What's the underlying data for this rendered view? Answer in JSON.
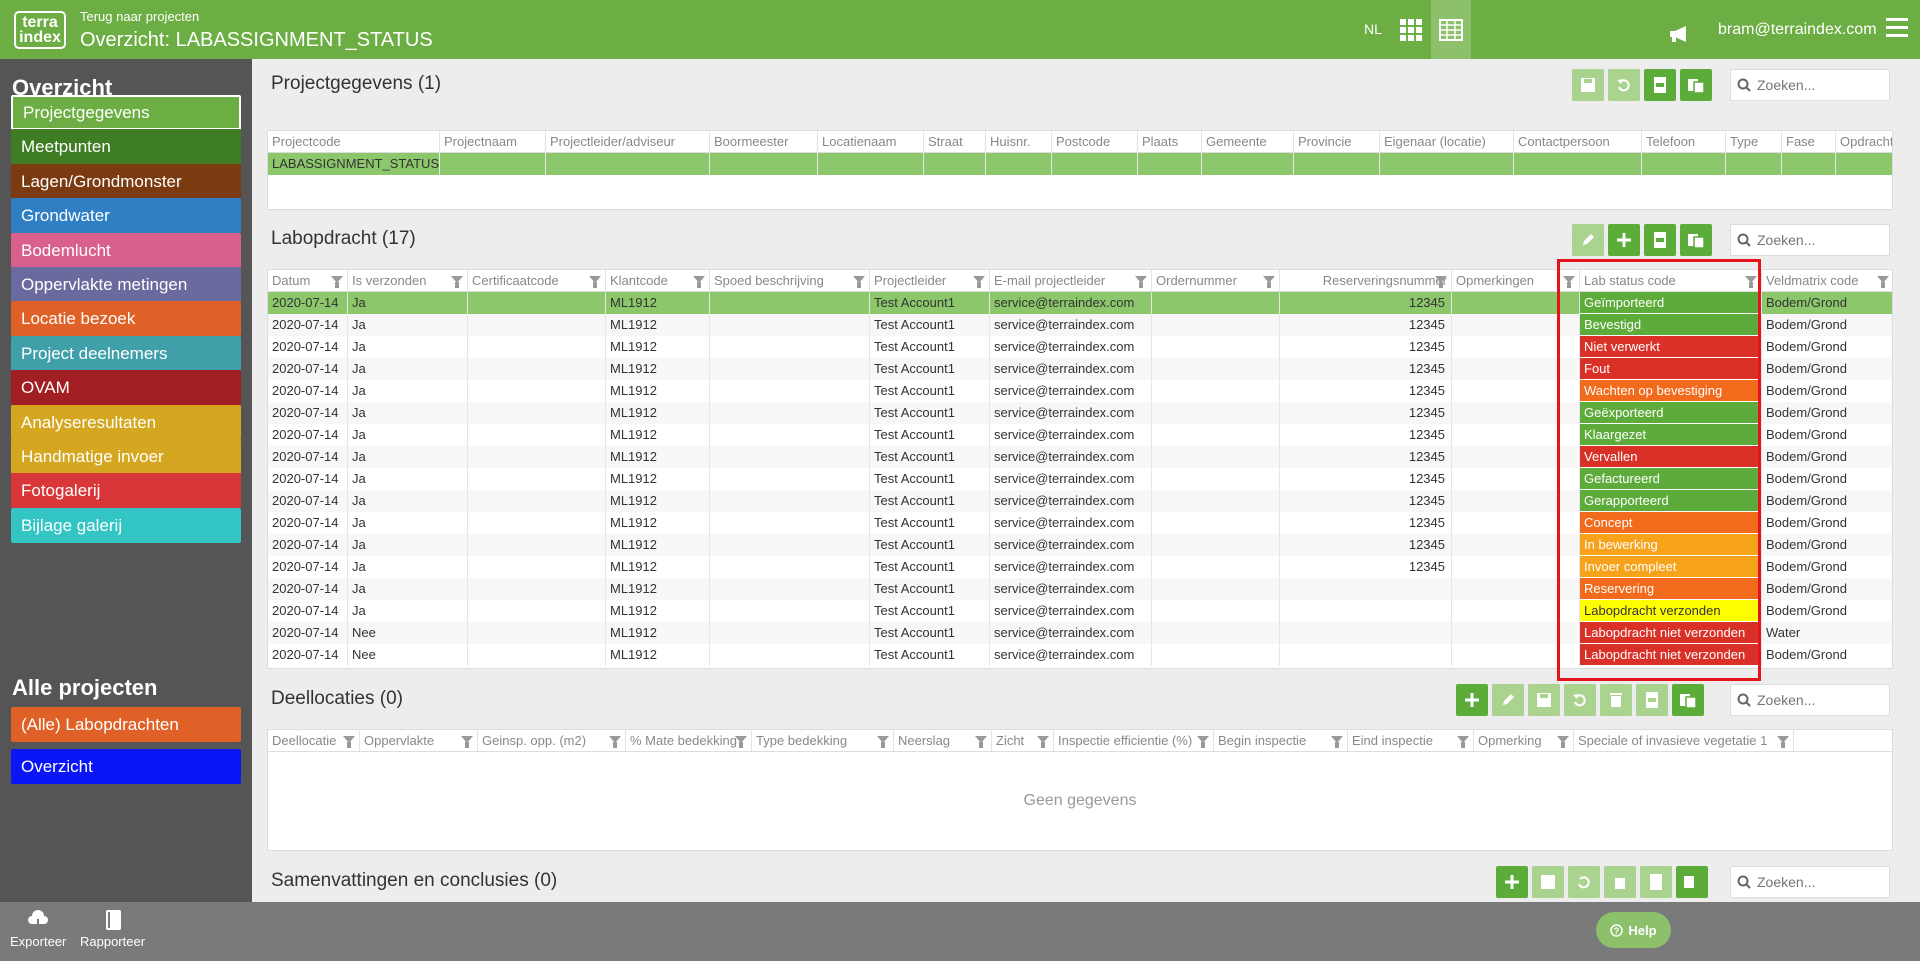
{
  "topbar": {
    "logo_line1": "terra",
    "logo_line2": "index",
    "back_link": "Terug naar projecten",
    "title": "Overzicht: LABASSIGNMENT_STATUS",
    "lang": "NL",
    "user": "bram@terraindex.com"
  },
  "sidebar": {
    "heading1": "Overzicht",
    "heading2": "Alle projecten",
    "items": [
      {
        "label": "Projectgegevens",
        "color": "#6cae43"
      },
      {
        "label": "Meetpunten",
        "color": "#3f7d24"
      },
      {
        "label": "Lagen/Grondmonster",
        "color": "#7b3a10"
      },
      {
        "label": "Grondwater",
        "color": "#2f7fc4"
      },
      {
        "label": "Bodemlucht",
        "color": "#d9608c"
      },
      {
        "label": "Oppervlakte metingen",
        "color": "#6a6a9e"
      },
      {
        "label": "Locatie bezoek",
        "color": "#e06127"
      },
      {
        "label": "Project deelnemers",
        "color": "#40a0aa"
      },
      {
        "label": "OVAM",
        "color": "#a11f22"
      },
      {
        "label": "Analyseresultaten",
        "color": "#d5a61f"
      },
      {
        "label": "Handmatige invoer",
        "color": "#d5a61f"
      },
      {
        "label": "Fotogalerij",
        "color": "#d93639"
      },
      {
        "label": "Bijlage galerij",
        "color": "#33c4c4"
      }
    ],
    "items2": [
      {
        "label": "(Alle) Labopdrachten",
        "color": "#e06127"
      },
      {
        "label": "Overzicht",
        "color": "#0a16f5"
      }
    ]
  },
  "project": {
    "title": "Projectgegevens (1)",
    "search_placeholder": "Zoeken...",
    "columns": [
      "Projectcode",
      "Projectnaam",
      "Projectleider/adviseur",
      "Boormeester",
      "Locatienaam",
      "Straat",
      "Huisnr.",
      "Postcode",
      "Plaats",
      "Gemeente",
      "Provincie",
      "Eigenaar (locatie)",
      "Contactpersoon",
      "Telefoon",
      "Type",
      "Fase",
      "Opdracht"
    ],
    "row": [
      "LABASSIGNMENT_STATUS",
      "",
      "",
      "",
      "",
      "",
      "",
      "",
      "",
      "",
      "",
      "",
      "",
      "",
      "",
      "",
      ""
    ]
  },
  "labo": {
    "title": "Labopdracht (17)",
    "search_placeholder": "Zoeken...",
    "columns": [
      "Datum",
      "Is verzonden",
      "Certificaatcode",
      "Klantcode",
      "Spoed beschrijving",
      "Projectleider",
      "E-mail projectleider",
      "Ordernummer",
      "Reserveringsnummer",
      "Opmerkingen",
      "Lab status code",
      "Veldmatrix code"
    ],
    "rows": [
      [
        "2020-07-14",
        "Ja",
        "",
        "ML1912",
        "",
        "Test Account1",
        "service@terraindex.com",
        "",
        "12345",
        "",
        "Geïmporteerd",
        "Bodem/Grond"
      ],
      [
        "2020-07-14",
        "Ja",
        "",
        "ML1912",
        "",
        "Test Account1",
        "service@terraindex.com",
        "",
        "12345",
        "",
        "Bevestigd",
        "Bodem/Grond"
      ],
      [
        "2020-07-14",
        "Ja",
        "",
        "ML1912",
        "",
        "Test Account1",
        "service@terraindex.com",
        "",
        "12345",
        "",
        "Niet verwerkt",
        "Bodem/Grond"
      ],
      [
        "2020-07-14",
        "Ja",
        "",
        "ML1912",
        "",
        "Test Account1",
        "service@terraindex.com",
        "",
        "12345",
        "",
        "Fout",
        "Bodem/Grond"
      ],
      [
        "2020-07-14",
        "Ja",
        "",
        "ML1912",
        "",
        "Test Account1",
        "service@terraindex.com",
        "",
        "12345",
        "",
        "Wachten op bevestiging",
        "Bodem/Grond"
      ],
      [
        "2020-07-14",
        "Ja",
        "",
        "ML1912",
        "",
        "Test Account1",
        "service@terraindex.com",
        "",
        "12345",
        "",
        "Geëxporteerd",
        "Bodem/Grond"
      ],
      [
        "2020-07-14",
        "Ja",
        "",
        "ML1912",
        "",
        "Test Account1",
        "service@terraindex.com",
        "",
        "12345",
        "",
        "Klaargezet",
        "Bodem/Grond"
      ],
      [
        "2020-07-14",
        "Ja",
        "",
        "ML1912",
        "",
        "Test Account1",
        "service@terraindex.com",
        "",
        "12345",
        "",
        "Vervallen",
        "Bodem/Grond"
      ],
      [
        "2020-07-14",
        "Ja",
        "",
        "ML1912",
        "",
        "Test Account1",
        "service@terraindex.com",
        "",
        "12345",
        "",
        "Gefactureerd",
        "Bodem/Grond"
      ],
      [
        "2020-07-14",
        "Ja",
        "",
        "ML1912",
        "",
        "Test Account1",
        "service@terraindex.com",
        "",
        "12345",
        "",
        "Gerapporteerd",
        "Bodem/Grond"
      ],
      [
        "2020-07-14",
        "Ja",
        "",
        "ML1912",
        "",
        "Test Account1",
        "service@terraindex.com",
        "",
        "12345",
        "",
        "Concept",
        "Bodem/Grond"
      ],
      [
        "2020-07-14",
        "Ja",
        "",
        "ML1912",
        "",
        "Test Account1",
        "service@terraindex.com",
        "",
        "12345",
        "",
        "In bewerking",
        "Bodem/Grond"
      ],
      [
        "2020-07-14",
        "Ja",
        "",
        "ML1912",
        "",
        "Test Account1",
        "service@terraindex.com",
        "",
        "12345",
        "",
        "Invoer compleet",
        "Bodem/Grond"
      ],
      [
        "2020-07-14",
        "Ja",
        "",
        "ML1912",
        "",
        "Test Account1",
        "service@terraindex.com",
        "",
        "",
        "",
        "Reservering",
        "Bodem/Grond"
      ],
      [
        "2020-07-14",
        "Ja",
        "",
        "ML1912",
        "",
        "Test Account1",
        "service@terraindex.com",
        "",
        "",
        "",
        "Labopdracht verzonden",
        "Bodem/Grond"
      ],
      [
        "2020-07-14",
        "Nee",
        "",
        "ML1912",
        "",
        "Test Account1",
        "service@terraindex.com",
        "",
        "",
        "",
        "Labopdracht niet verzonden",
        "Water"
      ],
      [
        "2020-07-14",
        "Nee",
        "",
        "ML1912",
        "",
        "Test Account1",
        "service@terraindex.com",
        "",
        "",
        "",
        "Labopdracht niet verzonden",
        "Bodem/Grond"
      ]
    ],
    "status_colors": [
      "#5dac3b",
      "#5dac3b",
      "#d93127",
      "#d93127",
      "#f26a1b",
      "#5dac3b",
      "#5dac3b",
      "#d93127",
      "#5dac3b",
      "#5dac3b",
      "#f26a1b",
      "#f7a21b",
      "#f7a21b",
      "#f26a1b",
      "#ffff00",
      "#d93127",
      "#d93127"
    ]
  },
  "deel": {
    "title": "Deellocaties (0)",
    "search_placeholder": "Zoeken...",
    "columns": [
      "Deellocatie",
      "Oppervlakte",
      "Geinsp. opp. (m2)",
      "% Mate bedekking",
      "Type bedekking",
      "Neerslag",
      "Zicht",
      "Inspectie efficientie (%)",
      "Begin inspectie",
      "Eind inspectie",
      "Opmerking",
      "Speciale of invasieve vegetatie 1"
    ],
    "empty": "Geen gegevens"
  },
  "samen": {
    "title": "Samenvattingen en conclusies (0)",
    "search_placeholder": "Zoeken..."
  },
  "footer": {
    "export": "Exporteer",
    "report": "Rapporteer",
    "help": "Help"
  }
}
